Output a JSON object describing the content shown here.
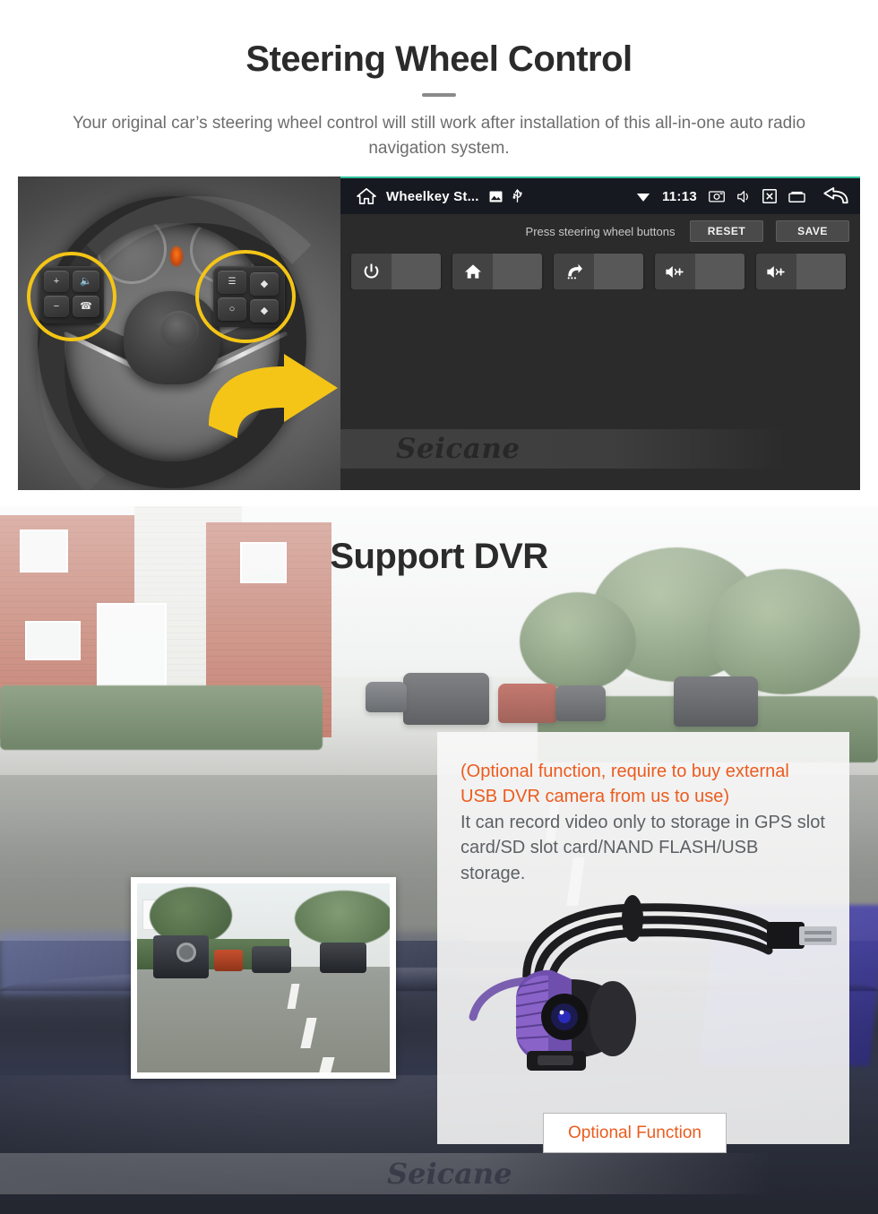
{
  "swc": {
    "title": "Steering Wheel Control",
    "subtitle": "Your original car’s steering wheel control will still work after installation of this all-in-one auto radio navigation system.",
    "watermark": "Seicane",
    "wheel_keys": {
      "left_pad": [
        "+",
        "−",
        "mute-speaker",
        "phone-call"
      ],
      "right_pad": [
        "list-menu",
        "diamond-up",
        "circle-arrow",
        "diamond-down"
      ]
    }
  },
  "radio": {
    "status_bar": {
      "home_icon": "home-icon",
      "title": "Wheelkey St...",
      "image_icon": "image-icon",
      "usb_icon": "usb-icon",
      "wifi_icon": "wifi-icon",
      "time": "11:13",
      "screenshot_icon": "screenshot-icon",
      "mute_icon": "mute-speaker-icon",
      "screen_off_icon": "screen-off-icon",
      "recents_icon": "recents-icon",
      "back_icon": "back-arrow-icon"
    },
    "prompt": "Press steering wheel buttons",
    "reset_label": "RESET",
    "save_label": "SAVE",
    "keys": [
      {
        "icon": "power-icon",
        "name": "power"
      },
      {
        "icon": "home-icon",
        "name": "home"
      },
      {
        "icon": "back-icon",
        "name": "back"
      },
      {
        "icon": "volume-up-icon",
        "name": "volume-up-1"
      },
      {
        "icon": "volume-up-icon",
        "name": "volume-up-2"
      }
    ],
    "accent_color": "#2fbf9a"
  },
  "dvr": {
    "title": "Support DVR",
    "note_red": "(Optional function, require to buy external USB DVR camera from us to use)",
    "note_grey": "It can record video only to storage in GPS slot card/SD slot card/NAND FLASH/USB storage.",
    "optional_button": "Optional Function",
    "watermark": "Seicane",
    "red_color": "#ec5b1e",
    "grey_color": "#5d6164"
  }
}
